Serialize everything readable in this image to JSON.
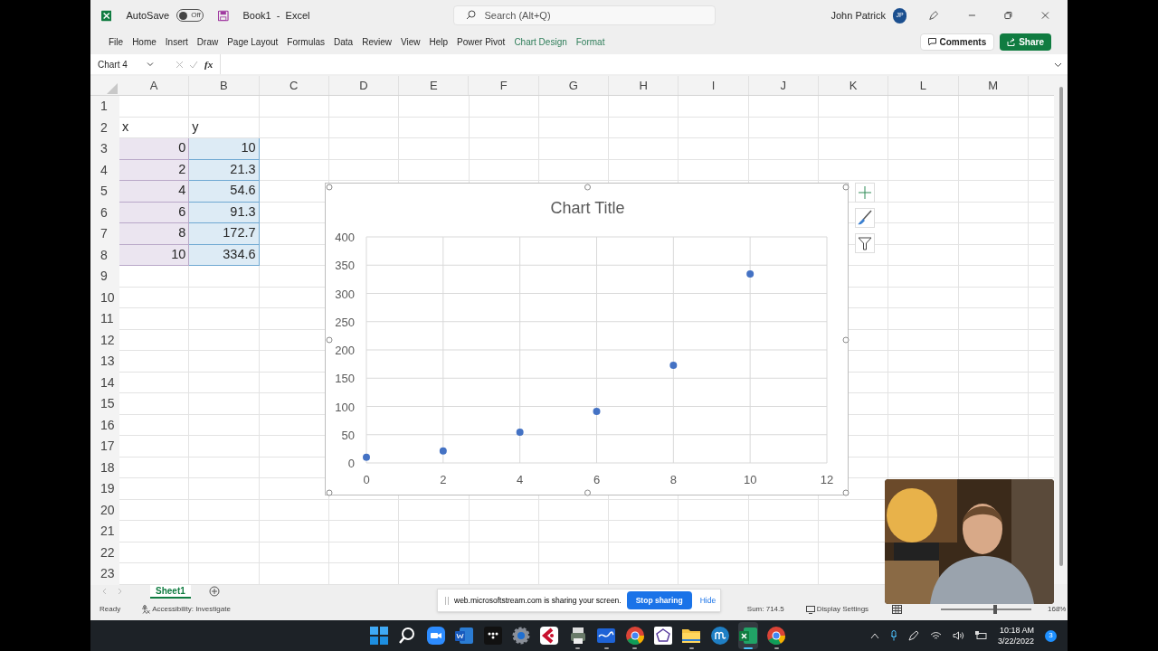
{
  "title_bar": {
    "autosave_label": "AutoSave",
    "autosave": false,
    "autosave_state": "Off",
    "document": "Book1",
    "separator": "-",
    "app": "Excel",
    "search": {
      "placeholder": "Search (Alt+Q)"
    },
    "user": "John Patrick",
    "avatar": "JP"
  },
  "ribbon_tabs": [
    {
      "label": "File",
      "contextual": false
    },
    {
      "label": "Home",
      "contextual": false
    },
    {
      "label": "Insert",
      "contextual": false
    },
    {
      "label": "Draw",
      "contextual": false
    },
    {
      "label": "Page Layout",
      "contextual": false
    },
    {
      "label": "Formulas",
      "contextual": false
    },
    {
      "label": "Data",
      "contextual": false
    },
    {
      "label": "Review",
      "contextual": false
    },
    {
      "label": "View",
      "contextual": false
    },
    {
      "label": "Help",
      "contextual": false
    },
    {
      "label": "Power Pivot",
      "contextual": false
    },
    {
      "label": "Chart Design",
      "contextual": true
    },
    {
      "label": "Format",
      "contextual": true
    }
  ],
  "buttons": {
    "comments": "Comments",
    "share": "Share"
  },
  "formula_bar": {
    "name_box": "Chart 4",
    "fx": "fx"
  },
  "columns": [
    "A",
    "B",
    "C",
    "D",
    "E",
    "F",
    "G",
    "H",
    "I",
    "J",
    "K",
    "L",
    "M"
  ],
  "sheet_rows": [
    {
      "number": "1"
    },
    {
      "number": "2",
      "cells": [
        {
          "text": "x",
          "kind": "text"
        },
        {
          "text": "y",
          "kind": "text"
        }
      ]
    },
    {
      "number": "3",
      "cells": [
        {
          "text": "0",
          "kind": "number"
        },
        {
          "text": "10",
          "kind": "number"
        }
      ]
    },
    {
      "number": "4",
      "cells": [
        {
          "text": "2",
          "kind": "number"
        },
        {
          "text": "21.3",
          "kind": "number"
        }
      ]
    },
    {
      "number": "5",
      "cells": [
        {
          "text": "4",
          "kind": "number"
        },
        {
          "text": "54.6",
          "kind": "number"
        }
      ]
    },
    {
      "number": "6",
      "cells": [
        {
          "text": "6",
          "kind": "number"
        },
        {
          "text": "91.3",
          "kind": "number"
        }
      ]
    },
    {
      "number": "7",
      "cells": [
        {
          "text": "8",
          "kind": "number"
        },
        {
          "text": "172.7",
          "kind": "number"
        }
      ]
    },
    {
      "number": "8",
      "cells": [
        {
          "text": "10",
          "kind": "number"
        },
        {
          "text": "334.6",
          "kind": "number"
        }
      ]
    },
    {
      "number": "9"
    },
    {
      "number": "10"
    },
    {
      "number": "11"
    },
    {
      "number": "12"
    },
    {
      "number": "13"
    },
    {
      "number": "14"
    },
    {
      "number": "15"
    },
    {
      "number": "16"
    },
    {
      "number": "17"
    },
    {
      "number": "18"
    },
    {
      "number": "19"
    },
    {
      "number": "20"
    },
    {
      "number": "21"
    },
    {
      "number": "22"
    },
    {
      "number": "23"
    }
  ],
  "chart": {
    "chart_data": {
      "type": "scatter",
      "title": "Chart Title",
      "x": [
        0,
        2,
        4,
        6,
        8,
        10
      ],
      "grid": true,
      "series": [
        {
          "color": "#4472c4",
          "values": [
            10,
            21.3,
            54.6,
            91.3,
            172.7,
            334.6
          ]
        }
      ],
      "xlim": [
        0,
        12
      ],
      "ylim": [
        0,
        400
      ],
      "xticks": [
        0,
        2,
        4,
        6,
        8,
        10,
        12
      ],
      "yticks": [
        0,
        50,
        100,
        150,
        200,
        250,
        300,
        350,
        400
      ]
    }
  },
  "sheet_tabs": [
    {
      "label": "Sheet1",
      "selected": true
    }
  ],
  "status_bar": {
    "ready": "Ready",
    "accessibility": "Accessibility: Investigate",
    "sum": "Sum: 714.5",
    "display_settings": "Display Settings",
    "zoom_slider": {
      "level": 0.6
    },
    "zoom": "168%"
  },
  "sharing_bar": {
    "message": "web.microsoftstream.com is sharing your screen.",
    "stop": "Stop sharing",
    "hide": "Hide"
  },
  "taskbar": {
    "apps": [
      {
        "kind": "start",
        "running": false,
        "active": false
      },
      {
        "kind": "search",
        "running": false,
        "active": false
      },
      {
        "kind": "video",
        "running": false,
        "active": false
      },
      {
        "kind": "word",
        "running": false,
        "active": false
      },
      {
        "kind": "dots",
        "running": false,
        "active": false
      },
      {
        "kind": "settings",
        "running": false,
        "active": false
      },
      {
        "kind": "red",
        "running": false,
        "active": false
      },
      {
        "kind": "printer",
        "running": true,
        "active": false
      },
      {
        "kind": "wave",
        "running": true,
        "active": false
      },
      {
        "kind": "chrome",
        "running": true,
        "active": false
      },
      {
        "kind": "pentagon",
        "running": false,
        "active": false
      },
      {
        "kind": "folder",
        "running": true,
        "active": false
      },
      {
        "kind": "mu",
        "running": false,
        "active": false
      },
      {
        "kind": "excel",
        "running": true,
        "active": true
      },
      {
        "kind": "chrome",
        "running": true,
        "active": false
      }
    ],
    "time": "10:18 AM",
    "date": "3/22/2022",
    "notifications": "3"
  }
}
